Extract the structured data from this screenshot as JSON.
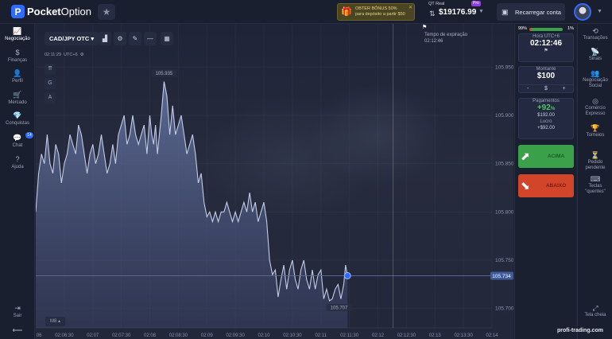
{
  "app": {
    "brand_first": "Pocket",
    "brand_second": "Option",
    "logo_letter": "P"
  },
  "header": {
    "bonus_line1": "OBTER BÔNUS 50%",
    "bonus_line2": "para depósito a partir $50",
    "account_type": "QT Real",
    "pro_badge": "Pro",
    "balance": "$19176.99",
    "reload_label": "Recarregar conta"
  },
  "left_nav": [
    {
      "icon": "chart-icon",
      "glyph": "📈",
      "label": "Negociação",
      "active": true
    },
    {
      "icon": "dollar-icon",
      "glyph": "$",
      "label": "Finanças"
    },
    {
      "icon": "user-icon",
      "glyph": "👤",
      "label": "Perfil"
    },
    {
      "icon": "cart-icon",
      "glyph": "🛒",
      "label": "Mercado"
    },
    {
      "icon": "diamond-icon",
      "glyph": "💎",
      "label": "Conquistas"
    },
    {
      "icon": "chat-icon",
      "glyph": "💬",
      "label": "Chat",
      "badge": "14"
    },
    {
      "icon": "help-icon",
      "glyph": "?",
      "label": "Ajuda"
    }
  ],
  "left_bottom": {
    "logout_label": "Sair"
  },
  "chart": {
    "pair": "CAD/JPY OTC",
    "clock": "02:11:29",
    "timezone": "UTC+6",
    "timeframe": "M8",
    "expiry_title": "Tempo de expiração",
    "expiry_time": "02:12:46",
    "peak_label": "105.935",
    "low_label": "105.707",
    "current_price": "105.734",
    "side_tools": [
      "⇈",
      "G",
      "A"
    ]
  },
  "chart_data": {
    "type": "area",
    "title": "",
    "xlabel": "",
    "ylabel": "",
    "ylim": [
      105.68,
      105.97
    ],
    "y_ticks": [
      "105.950",
      "105.900",
      "105.850",
      "105.800",
      "105.750",
      "105.700"
    ],
    "x_ticks": [
      "02:06",
      "02:06:30",
      "02:07",
      "02:07:30",
      "02:08",
      "02:08:30",
      "02:09",
      "02:09:30",
      "02:10",
      "02:10:30",
      "02:11",
      "02:11:30",
      "02:12",
      "02:12:30",
      "02:13",
      "02:13:30",
      "02:14"
    ],
    "x_ticks_secs": [
      0,
      30,
      60,
      90,
      120,
      150,
      180,
      210,
      240,
      270,
      300,
      330,
      360,
      390,
      420,
      450,
      480
    ],
    "series": [
      {
        "x_secs": [
          0,
          3,
          6,
          9,
          12,
          15,
          18,
          21,
          24,
          27,
          30,
          33,
          36,
          39,
          42,
          45,
          48,
          51,
          54,
          57,
          60,
          63,
          66,
          69,
          72,
          75,
          78,
          81,
          84,
          87,
          90,
          93,
          96,
          99,
          102,
          105,
          108,
          111,
          114,
          117,
          120,
          122,
          124,
          126,
          128,
          130,
          132,
          135,
          138,
          141,
          144,
          147,
          150,
          153,
          156,
          159,
          162,
          165,
          168,
          171,
          174,
          177,
          180,
          183,
          186,
          189,
          192,
          195,
          198,
          201,
          204,
          207,
          210,
          213,
          216,
          219,
          222,
          225,
          228,
          231,
          234,
          237,
          240,
          243,
          246,
          249,
          252,
          255,
          258,
          261,
          264,
          267,
          270,
          273,
          276,
          279,
          282,
          285,
          288,
          291,
          294,
          297,
          300,
          303,
          306,
          309,
          312,
          315,
          318,
          321,
          324,
          326,
          328
        ],
        "values": [
          105.8,
          105.84,
          105.86,
          105.85,
          105.88,
          105.85,
          105.84,
          105.87,
          105.86,
          105.83,
          105.85,
          105.86,
          105.88,
          105.87,
          105.86,
          105.89,
          105.88,
          105.86,
          105.84,
          105.86,
          105.87,
          105.85,
          105.86,
          105.88,
          105.86,
          105.84,
          105.85,
          105.87,
          105.85,
          105.88,
          105.89,
          105.9,
          105.87,
          105.88,
          105.9,
          105.88,
          105.87,
          105.88,
          105.89,
          105.86,
          105.9,
          105.88,
          105.87,
          105.89,
          105.86,
          105.88,
          105.9,
          105.935,
          105.92,
          105.88,
          105.91,
          105.88,
          105.89,
          105.9,
          105.88,
          105.86,
          105.87,
          105.88,
          105.86,
          105.83,
          105.84,
          105.81,
          105.795,
          105.8,
          105.79,
          105.8,
          105.79,
          105.8,
          105.8,
          105.81,
          105.8,
          105.79,
          105.8,
          105.79,
          105.8,
          105.81,
          105.8,
          105.82,
          105.8,
          105.81,
          105.79,
          105.8,
          105.81,
          105.79,
          105.75,
          105.735,
          105.74,
          105.712,
          105.73,
          105.745,
          105.72,
          105.74,
          105.75,
          105.73,
          105.72,
          105.74,
          105.75,
          105.73,
          105.72,
          105.74,
          105.72,
          105.735,
          105.74,
          105.71,
          105.72,
          105.708,
          105.71,
          105.72,
          105.725,
          105.71,
          105.725,
          105.745,
          105.734
        ]
      }
    ]
  },
  "trade_panel": {
    "sentiment_left": "99%",
    "sentiment_right": "1%",
    "time_caption": "Hora UTC+6",
    "time_value": "02:12:46",
    "amount_caption": "Montante",
    "amount_value": "$100",
    "amount_minus": "-",
    "amount_currency": "$",
    "amount_plus": "+",
    "payout_caption": "Pagamentos",
    "payout_value": "+92",
    "payout_pct": "%",
    "payout_total": "$192.00",
    "profit_caption": "Lucro",
    "profit_value": "+$92.00",
    "up_label": "ACIMA",
    "down_label": "ABAIXO"
  },
  "right_nav": [
    {
      "icon": "history-icon",
      "glyph": "⟲",
      "label": "Transações"
    },
    {
      "icon": "signal-icon",
      "glyph": "📡",
      "label": "Sinais"
    },
    {
      "icon": "social-icon",
      "glyph": "👥",
      "label": "Negociação Social"
    },
    {
      "icon": "express-icon",
      "glyph": "◎",
      "label": "Comércio Expresso"
    },
    {
      "icon": "trophy-icon",
      "glyph": "🏆",
      "label": "Torneios"
    },
    {
      "icon": "pending-icon",
      "glyph": "⏳",
      "label": "Pedido pendente"
    },
    {
      "icon": "keyboard-icon",
      "glyph": "⌨",
      "label": "Teclas \"quentes\""
    }
  ],
  "right_bottom": {
    "fullscreen_label": "Tela cheia"
  },
  "watermark": "profi-trading.com"
}
